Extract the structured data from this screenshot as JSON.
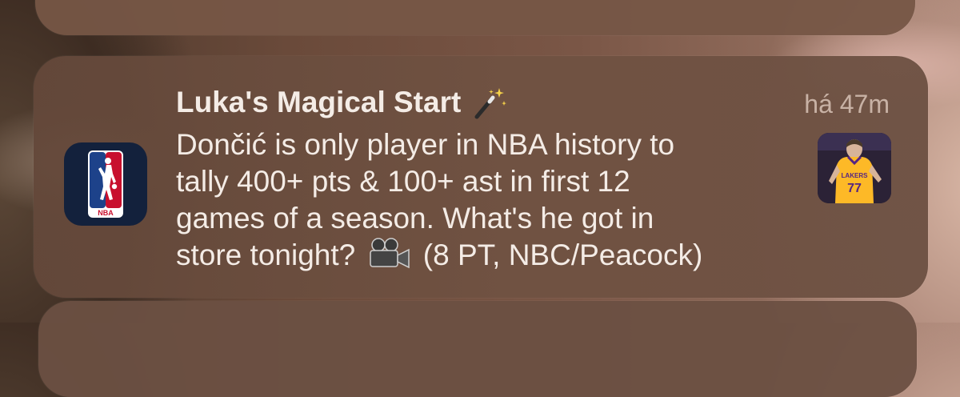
{
  "notification": {
    "title": "Luka's Magical Start",
    "title_icon": "magic-wand-icon",
    "timestamp": "há 47m",
    "body_line_1": "Dončić is only player in NBA history to",
    "body_line_2": "tally 400+ pts & 100+ ast in first 12",
    "body_line_3": "games of a season. What's he got in",
    "body_line_4_before": "store tonight?",
    "body_line_4_icon": "movie-camera-icon",
    "body_line_4_after": "(8 PT, NBC/Peacock)",
    "app_icon": "nba-logo-icon",
    "app_icon_text": "NBA",
    "thumbnail": "player-photo",
    "thumbnail_jersey_number": "77"
  },
  "colors": {
    "nba_blue": "#1d428a",
    "nba_red": "#c8102e",
    "lakers_gold": "#fdb927",
    "lakers_purple": "#552583"
  }
}
